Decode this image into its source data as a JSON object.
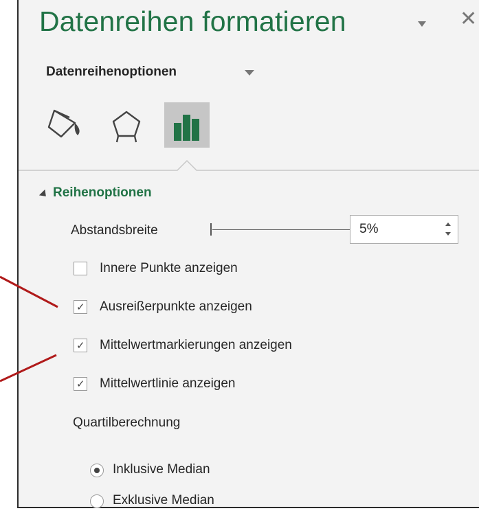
{
  "pane": {
    "title": "Datenreihen formatieren",
    "close_glyph": "✕"
  },
  "options_dropdown": {
    "label": "Datenreihenoptionen"
  },
  "tabs": [
    {
      "name": "Füllung und Linie",
      "icon": "paint-bucket-icon",
      "selected": false
    },
    {
      "name": "Effekte",
      "icon": "pentagon-icon",
      "selected": false
    },
    {
      "name": "Reihenoptionen",
      "icon": "bar-chart-icon",
      "selected": true
    }
  ],
  "section": {
    "title": "Reihenoptionen",
    "gap_width": {
      "label": "Abstandsbreite",
      "value": "5%",
      "percent": 5
    },
    "checkboxes": [
      {
        "label": "Innere Punkte anzeigen",
        "checked": false
      },
      {
        "label": "Ausreißerpunkte anzeigen",
        "checked": true
      },
      {
        "label": "Mittelwertmarkierungen anzeigen",
        "checked": true
      },
      {
        "label": "Mittelwertlinie anzeigen",
        "checked": true
      }
    ],
    "quartile": {
      "label": "Quartilberechnung",
      "options": [
        {
          "label": "Inklusive Median",
          "selected": true
        },
        {
          "label": "Exklusive Median",
          "selected": false
        }
      ]
    }
  },
  "colors": {
    "accent_green": "#217346",
    "annotation_red": "#b01a1a",
    "panel_bg": "#f3f3f3"
  }
}
